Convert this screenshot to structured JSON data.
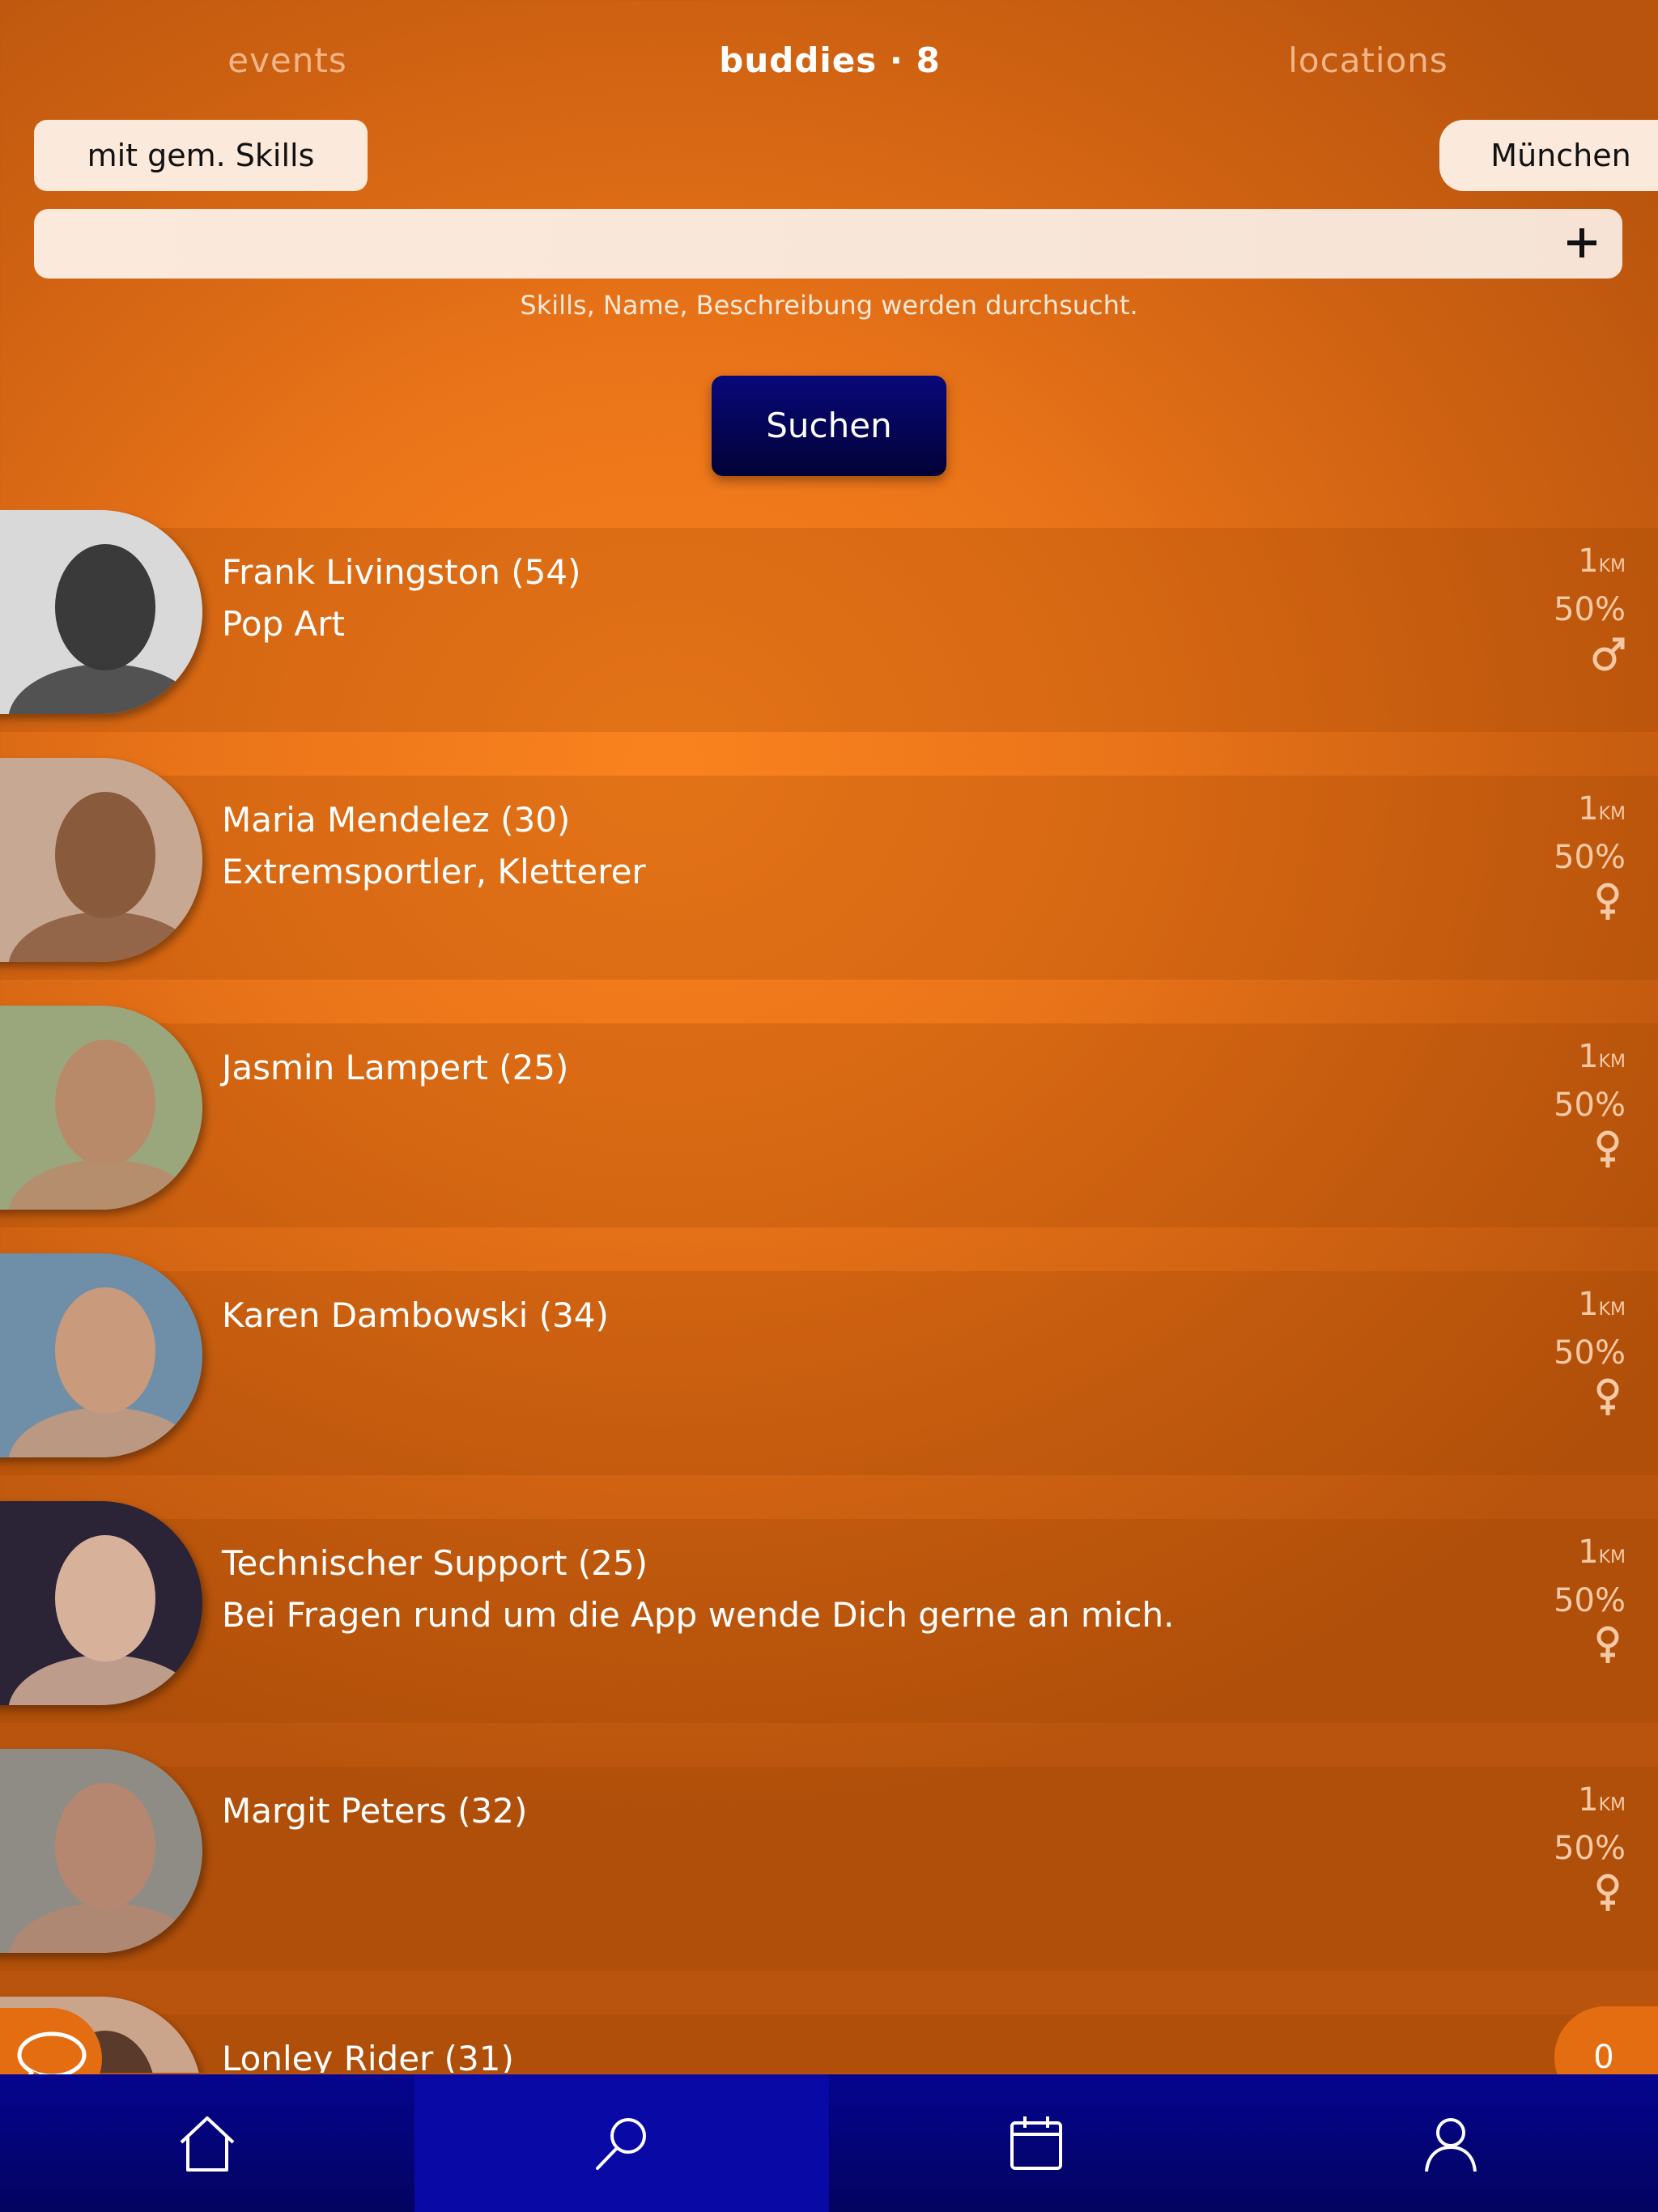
{
  "tabs": {
    "events": "events",
    "buddies": "buddies · 8",
    "locations": "locations"
  },
  "filters": {
    "skills_label": "mit gem. Skills",
    "city_label": "München"
  },
  "search": {
    "value": "",
    "hint": "Skills, Name, Beschreibung werden durchsucht.",
    "button_label": "Suchen"
  },
  "buddies": [
    {
      "name": "Frank Livingston (54)",
      "desc": "Pop Art",
      "dist": "1",
      "unit": "KM",
      "match": "50%",
      "gender": "male",
      "photo_colors": [
        "#d9d9d9",
        "#3a3a3a"
      ]
    },
    {
      "name": "Maria Mendelez (30)",
      "desc": "Extremsportler, Kletterer",
      "dist": "1",
      "unit": "KM",
      "match": "50%",
      "gender": "female",
      "photo_colors": [
        "#c7a993",
        "#8a5a3c"
      ]
    },
    {
      "name": "Jasmin Lampert (25)",
      "desc": "",
      "dist": "1",
      "unit": "KM",
      "match": "50%",
      "gender": "female",
      "photo_colors": [
        "#9aa77d",
        "#b88a6a"
      ]
    },
    {
      "name": "Karen Dambowski (34)",
      "desc": "",
      "dist": "1",
      "unit": "KM",
      "match": "50%",
      "gender": "female",
      "photo_colors": [
        "#6f8fa8",
        "#c99a7b"
      ]
    },
    {
      "name": "Technischer Support (25)",
      "desc": "Bei Fragen rund um die App wende Dich gerne an mich.",
      "dist": "1",
      "unit": "KM",
      "match": "50%",
      "gender": "female",
      "photo_colors": [
        "#2a2436",
        "#d8b19a"
      ]
    },
    {
      "name": "Margit Peters (32)",
      "desc": "",
      "dist": "1",
      "unit": "KM",
      "match": "50%",
      "gender": "female",
      "photo_colors": [
        "#8e8c84",
        "#b58770"
      ]
    },
    {
      "name": "Lonley Rider (31)",
      "desc": "",
      "dist": "",
      "unit": "",
      "match": "",
      "gender": "",
      "photo_colors": [
        "#caa58c",
        "#5a3a2a"
      ]
    }
  ],
  "chat_count": "0",
  "nav": {
    "items": [
      "home-icon",
      "search-icon",
      "calendar-icon",
      "profile-icon"
    ],
    "active": "search-icon"
  },
  "colors": {
    "accent": "#ea7419",
    "nav_bg": "#05058f",
    "button_bg": "#08087a",
    "pill_bg": "#fbe9dc"
  }
}
